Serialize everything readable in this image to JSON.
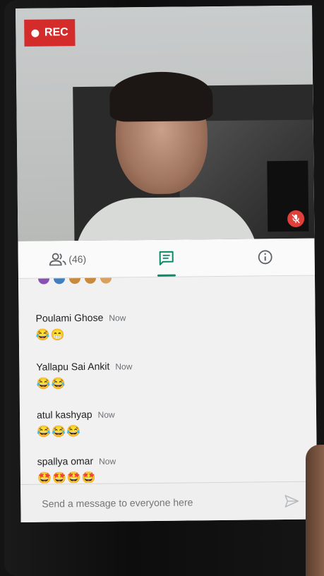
{
  "recording": {
    "label": "REC",
    "color": "#d42b2b"
  },
  "tabs": [
    {
      "name": "people",
      "icon": "people-icon",
      "count": "(46)"
    },
    {
      "name": "chat",
      "icon": "chat-icon",
      "active": true
    },
    {
      "name": "info",
      "icon": "info-icon"
    }
  ],
  "accent_color": "#0b8a6b",
  "messages": [
    {
      "sender": "Poulami Ghose",
      "time": "Now",
      "text": "😂😁"
    },
    {
      "sender": "Yallapu Sai Ankit",
      "time": "Now",
      "text": "😂😂"
    },
    {
      "sender": "atul kashyap",
      "time": "Now",
      "text": "😂😂😂"
    },
    {
      "sender": "spallya omar",
      "time": "Now",
      "text": "🤩🤩🤩🤩"
    }
  ],
  "composer": {
    "placeholder": "Send a message to everyone here",
    "send_icon": "send-icon"
  }
}
